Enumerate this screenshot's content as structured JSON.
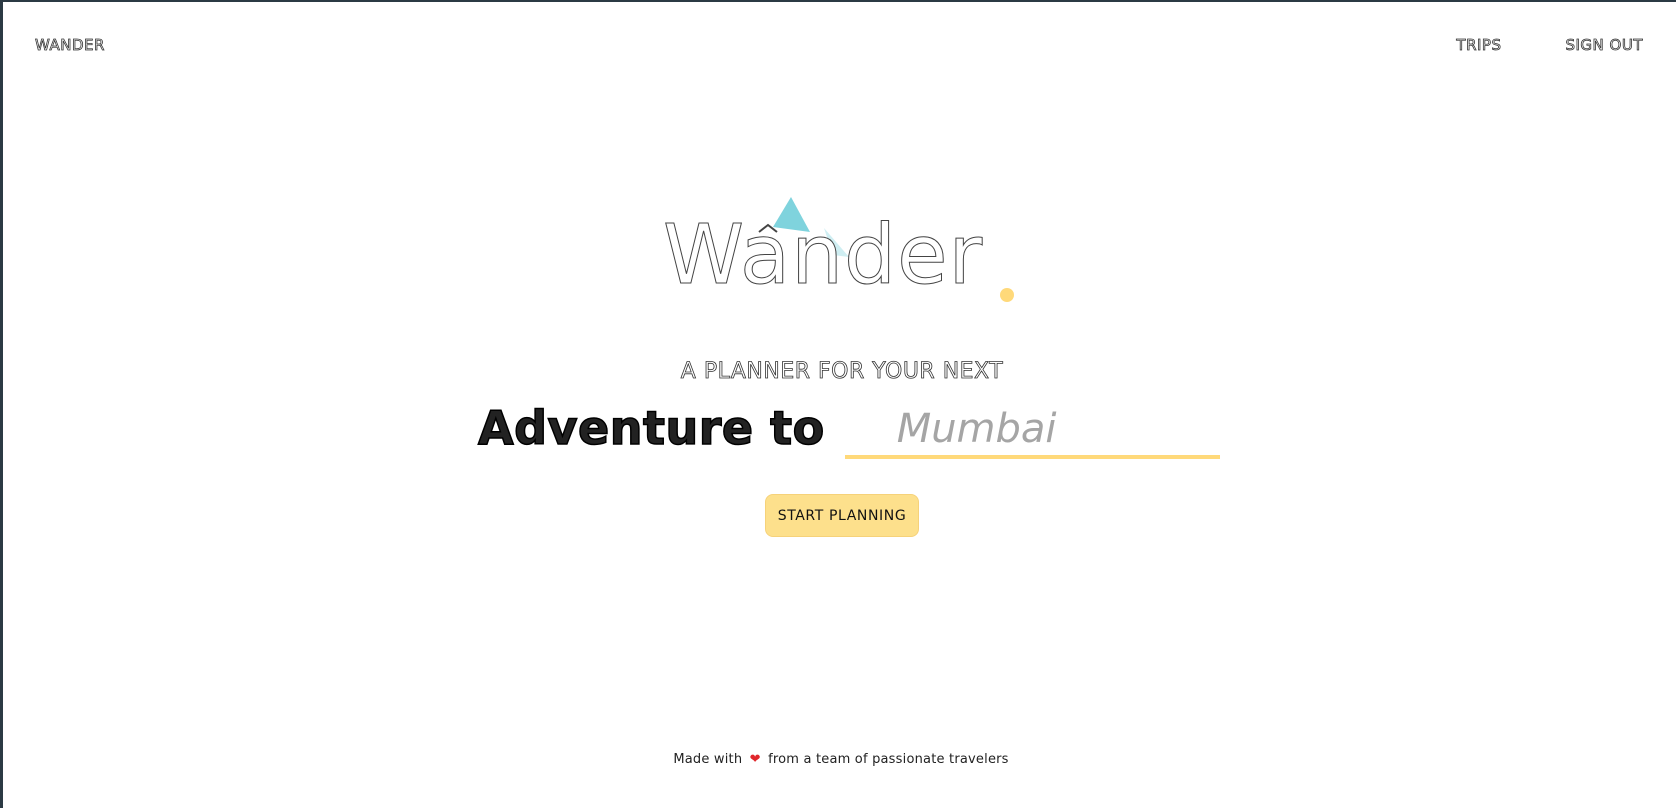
{
  "nav": {
    "brand": "WANDER",
    "links": [
      "TRIPS",
      "SIGN OUT"
    ]
  },
  "hero": {
    "logo_text": "Wander",
    "tagline": "A PLANNER FOR YOUR NEXT",
    "adventure_label": "Adventure to",
    "destination_placeholder": "Mumbai",
    "start_button": "START PLANNING"
  },
  "footer": {
    "prefix": "Made with",
    "heart_icon": "heart-icon",
    "suffix": "from a team of passionate travelers"
  },
  "colors": {
    "accent_yellow": "#fde08c",
    "underline_yellow": "#ffd97a",
    "logo_teal": "#7fd3dd",
    "logo_dot": "#ffd97a",
    "heart": "#e0262b"
  }
}
